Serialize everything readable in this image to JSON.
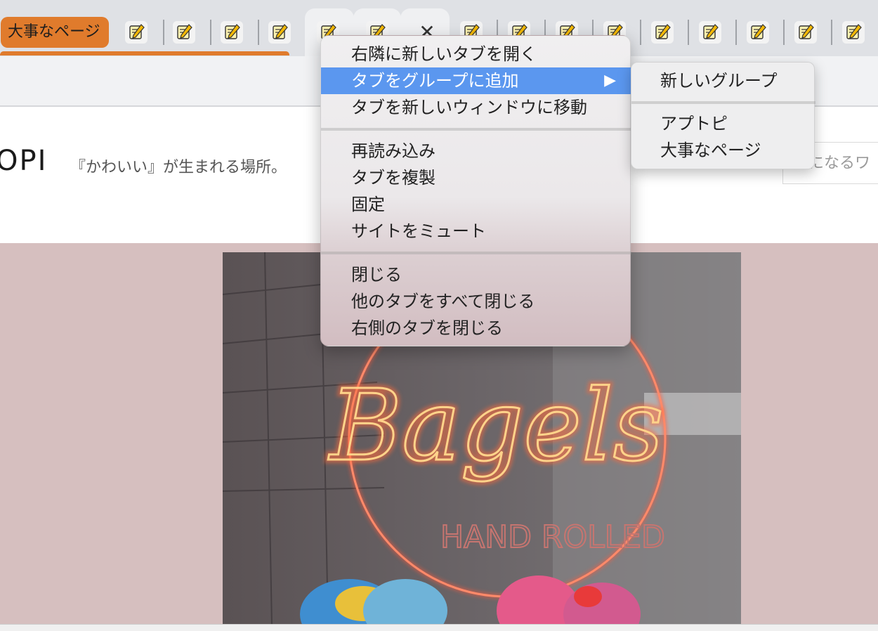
{
  "tab_group": {
    "label": "大事なページ",
    "color": "#e07b2c"
  },
  "tabs": [
    {
      "favicon": "pencil-notepad-icon"
    },
    {
      "favicon": "pencil-notepad-icon"
    },
    {
      "favicon": "pencil-notepad-icon"
    },
    {
      "favicon": "pencil-notepad-icon"
    },
    {
      "favicon": "pencil-notepad-icon"
    },
    {
      "favicon": "pencil-notepad-icon"
    },
    {
      "favicon": "close-icon"
    },
    {
      "favicon": "pencil-notepad-icon"
    },
    {
      "favicon": "pencil-notepad-icon"
    },
    {
      "favicon": "pencil-notepad-icon"
    },
    {
      "favicon": "pencil-notepad-icon"
    },
    {
      "favicon": "pencil-notepad-icon"
    },
    {
      "favicon": "pencil-notepad-icon"
    },
    {
      "favicon": "pencil-notepad-icon"
    },
    {
      "favicon": "pencil-notepad-icon"
    },
    {
      "favicon": "pencil-notepad-icon"
    }
  ],
  "close_glyph": "✕",
  "page": {
    "logo": "OPI",
    "tagline": "『かわいい』が生まれる場所。",
    "search_placeholder": "気になるワ",
    "hero_sign_text": "Bagels",
    "hero_sign_sub": "HAND ROLLED",
    "hero_bg_color": "#d6bfbf"
  },
  "context_menu": {
    "groups": [
      [
        "右隣に新しいタブを開く",
        "タブをグループに追加",
        "タブを新しいウィンドウに移動"
      ],
      [
        "再読み込み",
        "タブを複製",
        "固定",
        "サイトをミュート"
      ],
      [
        "閉じる",
        "他のタブをすべて閉じる",
        "右側のタブを閉じる"
      ]
    ],
    "highlighted": "タブをグループに追加",
    "submenu_arrow": "▶",
    "highlight_color": "#5b97ef"
  },
  "submenu": {
    "new_group": "新しいグループ",
    "groups": [
      "アプトピ",
      "大事なページ"
    ]
  }
}
